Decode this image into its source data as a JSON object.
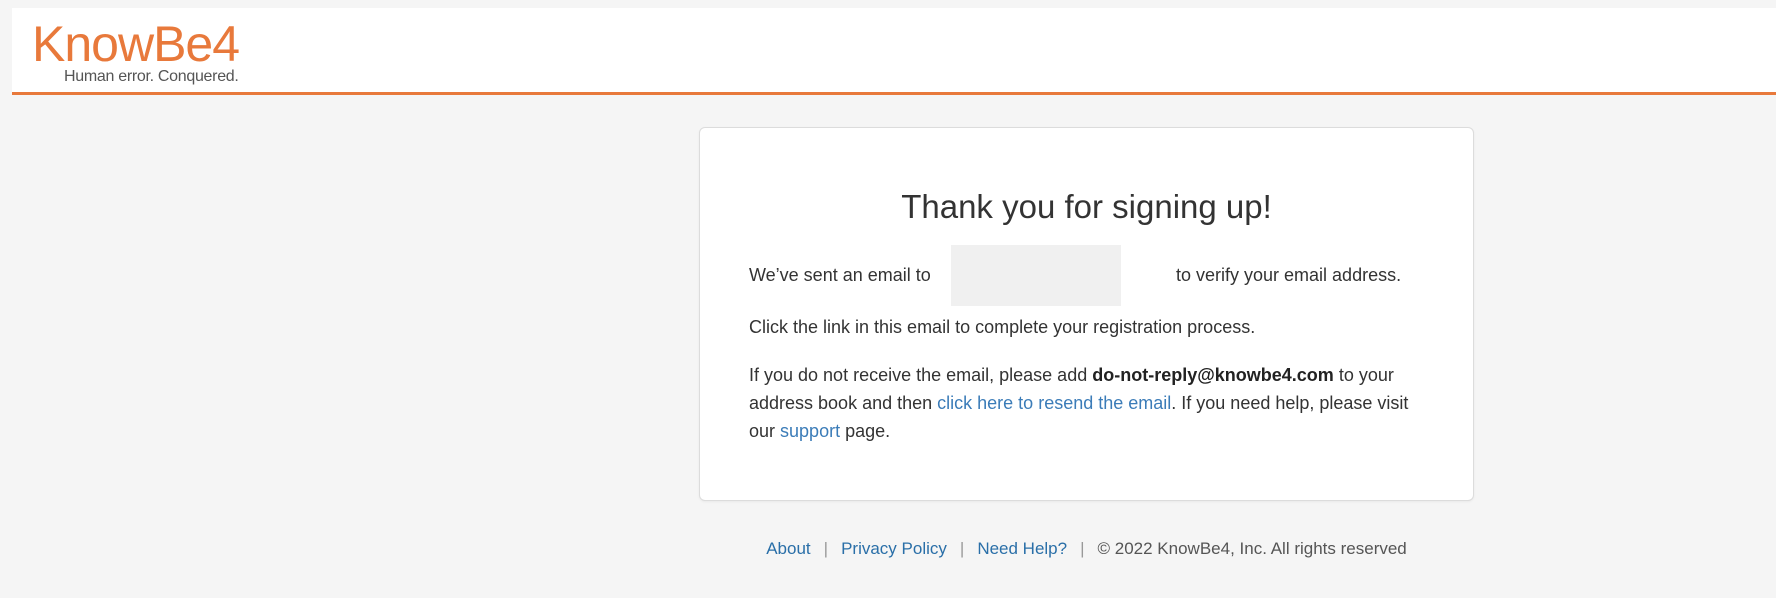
{
  "header": {
    "logo_text": "KnowBe4",
    "logo_tagline": "Human error. Conquered.",
    "accent_color": "#e8793b"
  },
  "card": {
    "title": "Thank you for signing up!",
    "line1_before": "We’ve sent an email to",
    "line1_after": "to verify your email address.",
    "line2": "Click the link in this email to complete your registration process.",
    "line3_part1": "If you do not receive the email, please add",
    "line3_email": "do-not-reply@knowbe4.com",
    "line3_part2": "to your address book and then",
    "resend_link": "click here to resend the email",
    "line3_part3": ". If you need help, please visit our",
    "support_link": "support",
    "line3_part4": "page."
  },
  "footer": {
    "about": "About",
    "privacy": "Privacy Policy",
    "help": "Need Help?",
    "copyright": "© 2022 KnowBe4, Inc. All rights reserved",
    "separator": "|"
  },
  "colors": {
    "link": "#3b7cb8",
    "background": "#f5f5f5"
  }
}
